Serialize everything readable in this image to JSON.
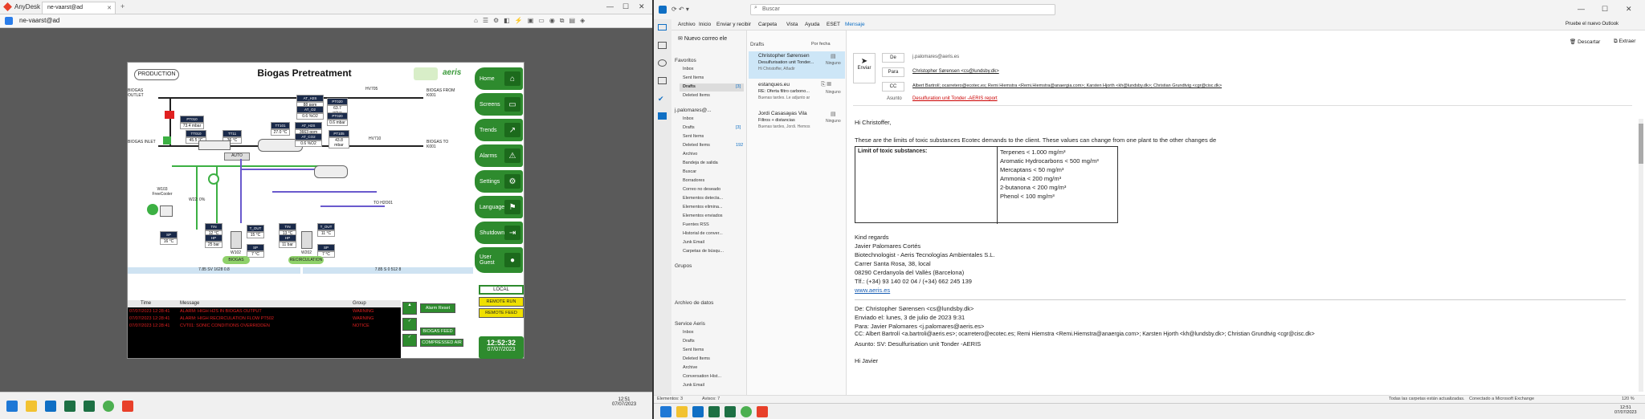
{
  "anydesk": {
    "app_name": "AnyDesk",
    "tab_label": "ne-vaarst@ad",
    "address": "ne-vaarst@ad"
  },
  "scada": {
    "production_label": "PRODUCTION",
    "title": "Biogas Pretreatment",
    "brand": "aeris",
    "nav": [
      "Home",
      "Screens",
      "Trends",
      "Alarms",
      "Settings",
      "Language",
      "Shutdown",
      "User\nGuest"
    ],
    "tags": {
      "hv705": "HV705",
      "biogas_outlet": "BIOGAS OUTLET",
      "biogas_inlet": "BIOGAS INLET",
      "biogas_from": "BIOGAS FROM K001",
      "biogas_to": "BIOGAS TO K001",
      "pt010_val": "73.4 mbar",
      "tt010_val": "45.5 °C",
      "tt11_val": "36 °C",
      "at_h2s_val": "88 ppm",
      "at_o2_val": "0.6 %O2",
      "pt020_val": "63.7 mbar",
      "pt020b_val": "0.6 mbar",
      "at_h2s2_val": "3663 ppm",
      "at_co2_val": "0.6 %O2",
      "tt101_val": "27.0 °C",
      "pt105_val": "43.8 mbar",
      "hv710": "HV710",
      "auto": "AUTO",
      "free_cooler": "W103\nFreeCooler",
      "w103_pct": "W22: 0%",
      "tin1": "12 °C",
      "tout1": "15 °C",
      "tin2": "13 °C",
      "tout2": "11 °C",
      "sp1": "16 °C",
      "hp1": "25 bar",
      "sp2": "7 °C",
      "hp2": "11 bar",
      "sp3": "7 °C",
      "w102": "W102",
      "w202": "W202",
      "flow_left": "7.85 SV 1628 0.8",
      "flow_right": "7.85 S 0 512 8",
      "biogas_btn": "BIOGAS",
      "recirc_btn": "RECIRCULATION",
      "to_h2o": "TO H2O01"
    },
    "alarm_headers": [
      "Time",
      "Message",
      "Group"
    ],
    "alarms": [
      {
        "time": "07/07/2023 12:28:41",
        "msg": "ALARM: HIGH H2S IN BIOGAS OUTPUT",
        "group": "WARNING"
      },
      {
        "time": "07/07/2023 12:28:41",
        "msg": "ALARM: HIGH RECIRCULATION FLOW PT502",
        "group": "WARNING"
      },
      {
        "time": "07/07/2023 12:28:41",
        "msg": "CVT01: SONIC CONDITIONS OVERRIDDEN",
        "group": "NOTICE"
      }
    ],
    "controls": {
      "alarm_reset": "Alarm Reset",
      "biogas_feed": "BIOGAS FEED",
      "compressed_air": "COMPRESSED AIR",
      "local": "LOCAL",
      "remote_run": "REMOTE RUN",
      "remote_feed": "REMOTE FEED"
    },
    "clock_time": "12:52:32",
    "clock_date": "07/07/2023"
  },
  "taskbar_left": {
    "time": "12:51",
    "date": "07/07/2023"
  },
  "outlook": {
    "search_placeholder": "Buscar",
    "try_new": "Pruebe el nuevo Outlook",
    "ribbon_tabs": [
      "Archivo",
      "Inicio",
      "Enviar y recibir",
      "Carpeta",
      "Vista",
      "Ayuda",
      "ESET",
      "Mensaje"
    ],
    "new_mail": "Nuevo correo ele",
    "discard": "Descartar",
    "pop_out": "Extraer",
    "folders": {
      "favoritos": "Favoritos",
      "fav_items": [
        "Inbox",
        "Sent Items",
        "Drafts",
        "Deleted Items"
      ],
      "account": "j.palomares@...",
      "acc_items": [
        "Inbox",
        "Drafts",
        "Sent Items",
        "Deleted Items",
        "Archivo",
        "Bandeja de salida",
        "Buscar",
        "Borradores",
        "Correo no deseado",
        "Elementos detecta...",
        "Elementos elimina...",
        "Elementos enviados",
        "Fuentes RSS",
        "Historial de conver...",
        "Junk Email",
        "Carpetas de búsqu..."
      ],
      "drafts_count": "[3]",
      "deleted_count": "192",
      "grupos": "Grupos",
      "archive_acc": "Archivo de datos",
      "service": "Service Aeris",
      "service_items": [
        "Inbox",
        "Drafts",
        "Sent Items",
        "Deleted Items",
        "Archive",
        "Conversation Hist...",
        "Junk Email"
      ]
    },
    "list_header": "Drafts",
    "sort": "Por fecha",
    "mails": [
      {
        "from": "Christopher Sørensen",
        "subject": "Desulfurisation unit Tonder...",
        "preview": "Hi Christoffer, Añadir",
        "tag": "Ninguno"
      },
      {
        "from": "estanques.eu",
        "subject": "RE: Oferta filtro carbono...",
        "preview": "Buenas tardes. Le adjunto ar",
        "tag": "Ninguno"
      },
      {
        "from": "Jordi Casasayas Vila",
        "subject": "Filtros + distancias",
        "preview": "Buenas tardes, Jordi. Hemos",
        "tag": "Ninguno"
      }
    ],
    "compose": {
      "send": "Enviar",
      "from_label": "De",
      "from_value": "j.palomares@aeris.es",
      "to_label": "Para",
      "to_value": "Christopher Sørensen <cs@lundsby.dk>",
      "cc_label": "CC",
      "cc_value": "Albert Bartrolí; ocarretero@ecotec.es; Remi Hiemstra <Remi.Hiemstra@anaergia.com>; Karsten Hjorth <kh@lundsby.dk>; Christian Grundtvig <cgr@cisc.dk>",
      "subject_label": "Asunto",
      "subject_value": "Desulfuration unit Tonder -AERIS report"
    },
    "body": {
      "greeting": "Hi Christoffer,",
      "line1": "These are the limits of toxic substances Ecotec demands to the client. These values can change from one plant to the other changes de",
      "table_head": "Limit of toxic substances:",
      "limits": [
        "Terpenes < 1.000 mg/m³",
        "Aromatic Hydrocarbons < 500 mg/m³",
        "Mercaptans < 50 mg/m³",
        "Ammonia < 200 mg/m³",
        "2-butanona < 200 mg/m³",
        "Phenol < 100 mg/m³"
      ],
      "regards": "Kind regards",
      "sig": [
        "Javier Palomares Cortés",
        "Biotechnologist - Aeris Tecnologías Ambientales S.L.",
        "Carrer Santa Rosa, 38, local",
        "08290 Cerdanyola del Vallès (Barcelona)",
        "Tlf.: (+34) 93 140 02 04 / (+34) 662 245 139"
      ],
      "web": "www.aeris.es",
      "q_from": "De: Christopher Sørensen <cs@lundsby.dk>",
      "q_sent": "Enviado el: lunes, 3 de julio de 2023 9:31",
      "q_to": "Para: Javier Palomares <j.palomares@aeris.es>",
      "q_cc": "CC: Albert Bartrolí <a.bartroli@aeris.es>; ocarretero@ecotec.es; Remi Hiemstra <Remi.Hiemstra@anaergia.com>; Karsten Hjorth <kh@lundsby.dk>; Christian Grundtvig <cgr@cisc.dk>",
      "q_subject": "Asunto: SV: Desulfurisation unit Tonder -AERIS",
      "q_hi": "Hi Javier"
    },
    "status": {
      "items": "Elementos: 3",
      "unread": "Avisos: 7",
      "sync": "Todas las carpetas están actualizadas.",
      "conn": "Conectado a Microsoft Exchange",
      "zoom": "120 %"
    }
  },
  "taskbar_right": {
    "time": "12:51",
    "date": "07/07/2023"
  }
}
